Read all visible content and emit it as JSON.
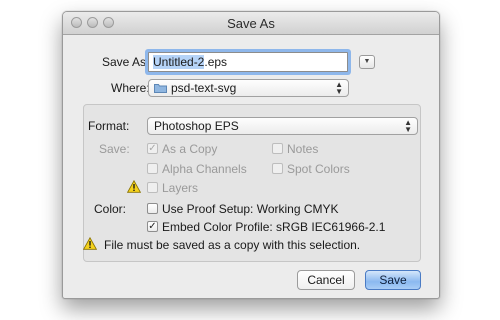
{
  "window": {
    "title": "Save As"
  },
  "top": {
    "save_as_label": "Save As:",
    "filename_base": "Untitled-2",
    "filename_ext": ".eps",
    "where_label": "Where:",
    "where_value": "psd-text-svg"
  },
  "options": {
    "format_label": "Format:",
    "format_value": "Photoshop EPS",
    "save_label": "Save:",
    "as_a_copy": {
      "label": "As a Copy",
      "checked": true,
      "enabled": false
    },
    "notes": {
      "label": "Notes",
      "checked": false,
      "enabled": false
    },
    "alpha_channels": {
      "label": "Alpha Channels",
      "checked": false,
      "enabled": false
    },
    "spot_colors": {
      "label": "Spot Colors",
      "checked": false,
      "enabled": false
    },
    "layers": {
      "label": "Layers",
      "checked": false,
      "enabled": false
    },
    "color_label": "Color:",
    "use_proof_setup": {
      "label": "Use Proof Setup:  Working CMYK",
      "checked": false,
      "enabled": true
    },
    "embed_color_profile": {
      "label": "Embed Color Profile:  sRGB IEC61966-2.1",
      "checked": true,
      "enabled": true
    },
    "warning_message": "File must be saved as a copy with this selection."
  },
  "buttons": {
    "cancel": "Cancel",
    "save": "Save"
  },
  "colors": {
    "accent": "#8eb7eb",
    "default_button": "#8bb9f0",
    "warning": "#f5d21c"
  }
}
